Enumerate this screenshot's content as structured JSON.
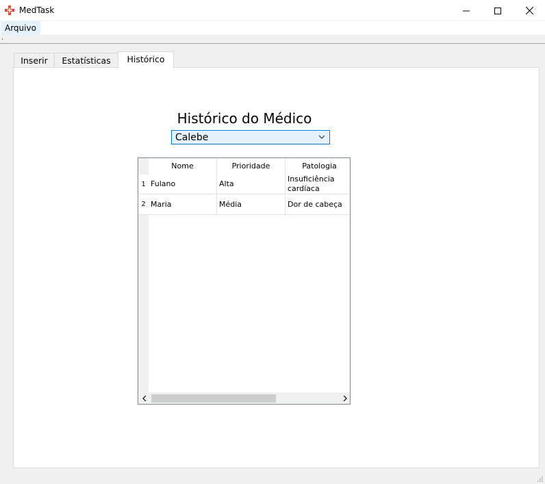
{
  "window": {
    "title": "MedTask",
    "icon": "red-cross-icon",
    "accent_color": "#e8452c"
  },
  "menu": {
    "items": [
      {
        "label": "Arquivo"
      }
    ]
  },
  "tabs": [
    {
      "label": "Inserir",
      "active": false
    },
    {
      "label": "Estatísticas",
      "active": false
    },
    {
      "label": "Histórico",
      "active": true
    }
  ],
  "main": {
    "heading": "Histórico do Médico",
    "doctor_select": {
      "value": "Calebe"
    }
  },
  "table": {
    "columns": [
      "Nome",
      "Prioridade",
      "Patologia"
    ],
    "rows": [
      {
        "num": "1",
        "cells": [
          "Fulano",
          "Alta",
          "Insuficiência cardíaca"
        ]
      },
      {
        "num": "2",
        "cells": [
          "Maria",
          "Média",
          "Dor de cabeça"
        ]
      }
    ]
  }
}
